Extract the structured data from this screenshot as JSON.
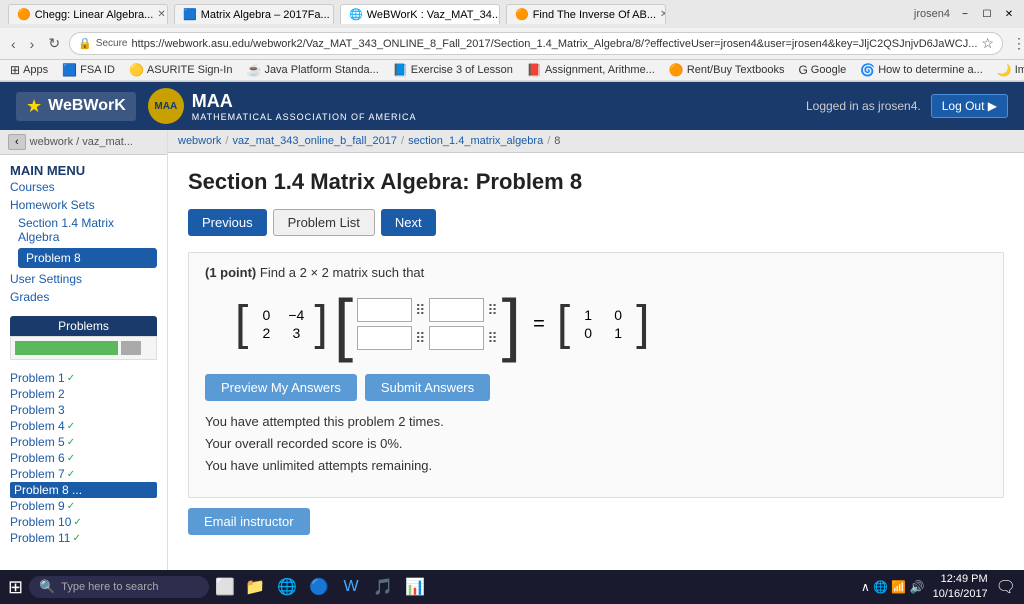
{
  "browser": {
    "tabs": [
      {
        "id": "tab1",
        "label": "Chegg: Linear Algebra...",
        "icon": "🟠",
        "active": false
      },
      {
        "id": "tab2",
        "label": "Matrix Algebra – 2017Fa...",
        "icon": "🟦",
        "active": false
      },
      {
        "id": "tab3",
        "label": "WeBWorK : Vaz_MAT_34...",
        "icon": "🌐",
        "active": true
      },
      {
        "id": "tab4",
        "label": "Find The Inverse Of AB...",
        "icon": "🟠",
        "active": false
      }
    ],
    "address": "https://webwork.asu.edu/webwork2/Vaz_MAT_343_ONLINE_8_Fall_2017/Section_1.4_Matrix_Algebra/8/?effectiveUser=jrosen4&user=jrosen4&key=JljC2QSJnjvD6JaWCJ...",
    "title_bar_user": "jrosen4",
    "bookmarks": [
      {
        "label": "Apps",
        "icon": "⊞"
      },
      {
        "label": "FSA ID",
        "icon": "F"
      },
      {
        "label": "ASURITE Sign-In",
        "icon": "A"
      },
      {
        "label": "Java Platform Standa...",
        "icon": "☕"
      },
      {
        "label": "Exercise 3 of Lesson",
        "icon": "📘"
      },
      {
        "label": "Assignment, Arithme...",
        "icon": "📕"
      },
      {
        "label": "Rent/Buy Textbooks",
        "icon": "🟠"
      },
      {
        "label": "Google",
        "icon": "G"
      },
      {
        "label": "How to determine a...",
        "icon": "🌀"
      },
      {
        "label": "Implement selection",
        "icon": "🌙"
      }
    ]
  },
  "header": {
    "webwork_label": "WeBWorK",
    "maa_label": "MAA",
    "maa_subtitle": "MATHEMATICAL ASSOCIATION OF AMERICA",
    "logged_in_text": "Logged in as jrosen4.",
    "logout_label": "Log Out ▶"
  },
  "breadcrumb_nav": {
    "items": [
      "webwork",
      "vaz_mat_343_online_b_fall_2017",
      "section_1.4_matrix_algebra",
      "8"
    ]
  },
  "sidebar": {
    "main_menu_label": "MAIN MENU",
    "courses_label": "Courses",
    "homework_sets_label": "Homework Sets",
    "section_link_label": "Section 1.4 Matrix Algebra",
    "active_problem_label": "Problem 8",
    "user_settings_label": "User Settings",
    "grades_label": "Grades",
    "problems_header": "Problems",
    "problem_items": [
      {
        "label": "Problem 1",
        "check": "✓",
        "active": false
      },
      {
        "label": "Problem 2",
        "check": "",
        "active": false
      },
      {
        "label": "Problem 3",
        "check": "",
        "active": false
      },
      {
        "label": "Problem 4",
        "check": "✓",
        "active": false
      },
      {
        "label": "Problem 5",
        "check": "✓",
        "active": false
      },
      {
        "label": "Problem 6",
        "check": "✓",
        "active": false
      },
      {
        "label": "Problem 7",
        "check": "✓",
        "active": false
      },
      {
        "label": "Problem 8 ...",
        "check": "",
        "active": true
      },
      {
        "label": "Problem 9",
        "check": "✓",
        "active": false
      },
      {
        "label": "Problem 10",
        "check": "✓",
        "active": false
      },
      {
        "label": "Problem 11",
        "check": "✓",
        "active": false
      }
    ]
  },
  "main": {
    "problem_title": "Section 1.4 Matrix Algebra: Problem 8",
    "nav_previous": "Previous",
    "nav_problem_list": "Problem List",
    "nav_next": "Next",
    "problem_points": "(1 point)",
    "problem_statement": "Find a 2 × 2 matrix such that",
    "matrix_A": [
      [
        "0",
        "−4"
      ],
      [
        "2",
        "3"
      ]
    ],
    "matrix_identity": [
      [
        "1",
        "0"
      ],
      [
        "0",
        "1"
      ]
    ],
    "preview_btn_label": "Preview My Answers",
    "submit_btn_label": "Submit Answers",
    "attempt_info_1": "You have attempted this problem 2 times.",
    "attempt_info_2": "Your overall recorded score is 0%.",
    "attempt_info_3": "You have unlimited attempts remaining.",
    "email_btn_label": "Email instructor"
  },
  "taskbar": {
    "search_placeholder": "Type here to search",
    "time": "12:49 PM",
    "date": "10/16/2017",
    "apps": [
      "⊞",
      "🎤",
      "⬜",
      "📁",
      "🔍",
      "🌐",
      "📧",
      "🎵",
      "📊"
    ]
  }
}
